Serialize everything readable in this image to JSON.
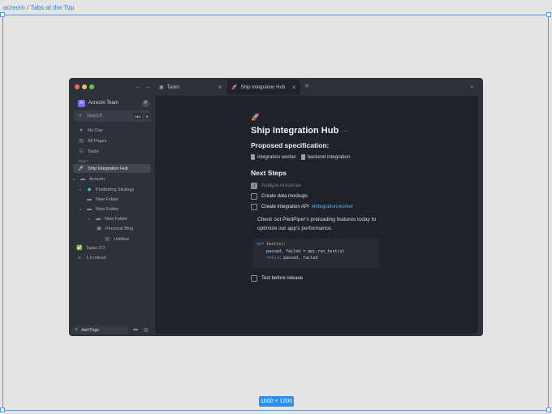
{
  "canvas": {
    "frame_label": "acreom / Tabs at the Top",
    "size_badge": "1600 × 1200"
  },
  "titlebar": {
    "tabs": [
      {
        "label": "Tasks",
        "icon": "checkbox-icon",
        "active": false
      },
      {
        "label": "Ship Integration Hub",
        "icon": "rocket-icon",
        "active": true
      }
    ]
  },
  "sidebar": {
    "team": {
      "avatar": "A",
      "name": "Acreom Team",
      "profile": "P"
    },
    "search": {
      "placeholder": "Search",
      "shortcut": [
        "Ctrl",
        "K"
      ]
    },
    "nav": [
      {
        "label": "My Day",
        "icon": "star-icon"
      },
      {
        "label": "All Pages",
        "icon": "pages-icon"
      },
      {
        "label": "Tasks",
        "icon": "checkbox-icon"
      }
    ],
    "section_label": "Pages",
    "pages": [
      {
        "label": "Ship Integration Hub",
        "icon": "rocket-icon",
        "active": true
      },
      {
        "label": "Acreom",
        "icon": "folder-icon"
      },
      {
        "label": "Publishing Strategy",
        "icon": "diamond-icon"
      },
      {
        "label": "New Folder",
        "icon": "folder-icon"
      },
      {
        "label": "New Folder",
        "icon": "folder-icon"
      },
      {
        "label": "New Folder",
        "icon": "folder-icon"
      },
      {
        "label": "Personal Blog",
        "icon": "image-icon"
      },
      {
        "label": "Untitled",
        "icon": "page-icon"
      },
      {
        "label": "Tasks 2.0",
        "icon": "check-badge-icon"
      },
      {
        "label": "1.0 rollout",
        "icon": "red-circle-icon"
      }
    ],
    "add_page_label": "Add Page"
  },
  "document": {
    "icon": "🚀",
    "title": "Ship Integration Hub",
    "title_more": "···",
    "spec_heading": "Proposed specification:",
    "spec_links": [
      "integration worker",
      "backend integration"
    ],
    "next_steps_heading": "Next Steps",
    "tasks": [
      {
        "label": "Analyze resources",
        "done": true,
        "tag": ""
      },
      {
        "label": "Create data mockups",
        "done": false,
        "tag": ""
      },
      {
        "label": "Create integration API",
        "done": false,
        "tag": "#integration-worker"
      }
    ],
    "paragraph": "Check out PiedPiper's preloading features today to optimize our app's performance.",
    "code": {
      "line1_kw": "def",
      "line1_fn": "test",
      "line1_rest": "(x):",
      "line2": "    passed, failed = api.run_test(x)",
      "line3_kw": "    return",
      "line3_rest": " passed, failed"
    },
    "last_task": {
      "label": "Test before release",
      "done": false
    }
  },
  "colors": {
    "window_bg": "#2d313a",
    "editor_bg": "#1f222a",
    "accent_link": "#5fb6e8",
    "team_avatar": "#7c6ff2",
    "selection_blue": "#4c9cf0"
  }
}
